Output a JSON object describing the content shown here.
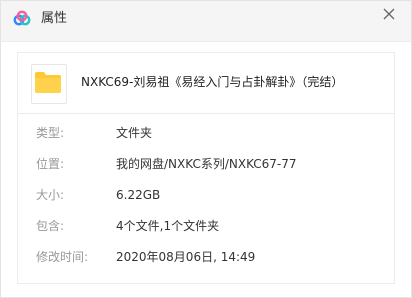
{
  "window": {
    "title": "属性",
    "icon": "baidu-netdisk-cloud-icon",
    "close_icon": "close-icon"
  },
  "file": {
    "icon": "folder-icon",
    "name": "NXKC69-刘易祖《易经入门与占卦解卦》（完结）"
  },
  "properties": [
    {
      "label": "类型:",
      "value": "文件夹"
    },
    {
      "label": "位置:",
      "value": "我的网盘/NXKC系列/NXKC67-77"
    },
    {
      "label": "大小:",
      "value": "6.22GB"
    },
    {
      "label": "包含:",
      "value": "4个文件,1个文件夹"
    },
    {
      "label": "修改时间:",
      "value": "2020年08月06日, 14:49"
    }
  ],
  "colors": {
    "folder": "#FFC933",
    "cloud_blue": "#2E8BFF",
    "cloud_pink": "#FF5B9A",
    "cloud_teal": "#23C6C8"
  }
}
